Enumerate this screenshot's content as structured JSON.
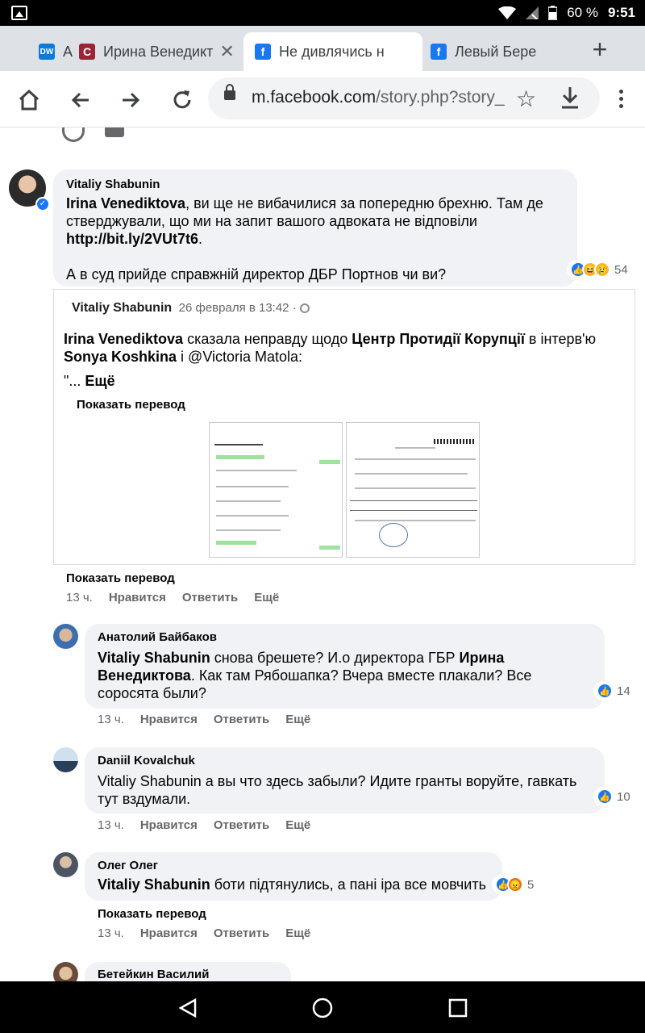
{
  "status": {
    "battery": "60 %",
    "time": "9:51"
  },
  "tabs": [
    {
      "favicon": "dw-icon",
      "title": "A",
      "color": "#0a7bd8"
    },
    {
      "favicon": "s-icon",
      "title": "Ирина Венедикт",
      "color": "#9b2335"
    },
    {
      "favicon": "facebook-icon",
      "title": "Не дивлячись н",
      "color": "#1877f2"
    },
    {
      "favicon": "facebook-icon",
      "title": "Левый Бере",
      "color": "#1877f2"
    }
  ],
  "omnibox": {
    "host": "m.facebook.com",
    "path": "/story.php?story_"
  },
  "main_comment": {
    "author": "Vitaliy Shabunin",
    "mention": "Irina Venediktova",
    "text1": ", ви ще не вибачилися за попередню брехню. Там де стверджували, що ми на запит вашого адвоката не відповіли ",
    "link": "http://bit.ly/2VUt7t6",
    "text2": ".",
    "text3": "А в суд прийде справжній директор ДБР Портнов чи ви?",
    "reaction_count": "54"
  },
  "shared_post": {
    "author": "Vitaliy Shabunin",
    "date": "26 февраля в 13:42 ·",
    "p1_name": "Irina Venediktova",
    "p1_t1": " сказала неправду щодо ",
    "p1_org": "Центр Протидії Корупції",
    "p1_t2": " в інтерв'ю ",
    "p1_name2": "Sonya Koshkina",
    "p1_t3": " і @Victoria Matola:",
    "p2": "\"... ",
    "more": "Ещё",
    "show_translation": "Показать перевод"
  },
  "main_meta": {
    "show_translation": "Показать перевод",
    "time": "13 ч.",
    "like": "Нравится",
    "reply": "Ответить",
    "more": "Ещё"
  },
  "replies": [
    {
      "author": "Анатолий Байбаков",
      "b1": "Vitaliy Shabunin",
      "t1": " снова брешете? И.о директора ГБР ",
      "b2": "Ирина Венедиктова",
      "t2": ". Как там Рябошапка? Вчера вместе плакали? Все соросята были?",
      "count": "14",
      "time": "13 ч.",
      "like": "Нравится",
      "reply": "Ответить",
      "more": "Ещё"
    },
    {
      "author": "Daniil Kovalchuk",
      "t1": "Vitaliy Shabunin а вы что здесь забыли? Идите гранты воруйте, гавкать тут вздумали.",
      "count": "10",
      "time": "13 ч.",
      "like": "Нравится",
      "reply": "Ответить",
      "more": "Ещё"
    },
    {
      "author": "Олег Олег",
      "b1": "Vitaliy Shabunin",
      "t1": " боти підтянулись, а пані іра все мовчить",
      "count": "5",
      "show_translation": "Показать перевод",
      "time": "13 ч.",
      "like": "Нравится",
      "reply": "Ответить",
      "more": "Ещё"
    },
    {
      "author": "Бетейкин Василий"
    }
  ]
}
